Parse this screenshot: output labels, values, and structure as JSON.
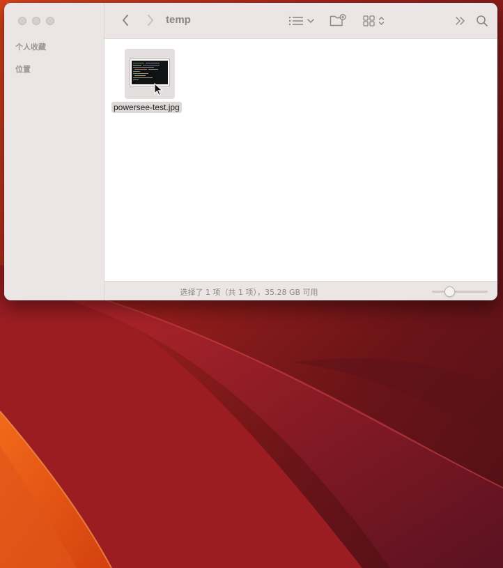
{
  "window": {
    "title": "temp"
  },
  "sidebar": {
    "sections": [
      {
        "label": "个人收藏"
      },
      {
        "label": "位置"
      }
    ]
  },
  "toolbar": {
    "icons": [
      "back-chevron-icon",
      "forward-chevron-icon",
      "list-view-icon",
      "chevron-down-icon",
      "new-folder-icon",
      "grid-view-icon",
      "sort-chevron-icon",
      "more-chevron-icon",
      "search-icon"
    ]
  },
  "files": [
    {
      "name": "powersee-test.jpg",
      "selected": true
    }
  ],
  "status": {
    "text": "选择了 1 项（共 1 项），35.28 GB 可用"
  },
  "icon_size_slider": {
    "level": 0.27
  },
  "colors": {
    "sidebar_bg": "#ebe6e5",
    "content_bg": "#ffffff",
    "wallpaper_dark": "#5a1014",
    "wallpaper_orange": "#e8540f",
    "selection_bg": "#dcd8d7"
  }
}
